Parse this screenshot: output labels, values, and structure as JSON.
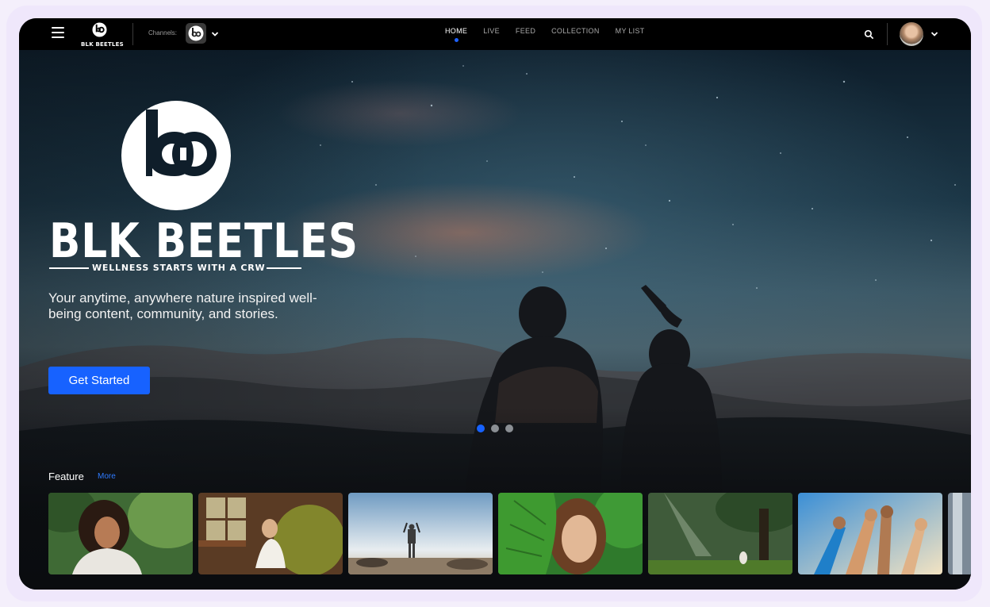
{
  "brand": {
    "name": "BLK BEETLES",
    "tagline": "WELLNESS STARTS WITH A CRW",
    "logo_icon": "bb-logo-icon"
  },
  "topbar": {
    "menu_icon": "menu-icon",
    "channels_label": "Channels:",
    "nav": [
      {
        "label": "HOME",
        "active": true
      },
      {
        "label": "LIVE",
        "active": false
      },
      {
        "label": "FEED",
        "active": false
      },
      {
        "label": "COLLECTION",
        "active": false
      },
      {
        "label": "MY LIST",
        "active": false
      }
    ],
    "search_icon": "search-icon",
    "profile_chevron_icon": "chevron-down-icon"
  },
  "hero": {
    "description": "Your anytime, anywhere nature inspired well-being content, community, and stories.",
    "cta_label": "Get Started",
    "slides_total": 3,
    "active_slide": 1
  },
  "feature": {
    "title": "Feature",
    "more_label": "More",
    "cards": [
      {
        "subject": "smiling woman with curly hair"
      },
      {
        "subject": "woman meditating near window"
      },
      {
        "subject": "person with raised arms on beach"
      },
      {
        "subject": "woman behind monstera leaf"
      },
      {
        "subject": "person sitting in sunlit forest"
      },
      {
        "subject": "raised hands against sky"
      },
      {
        "subject": "partial card"
      }
    ]
  },
  "colors": {
    "accent": "#1762ff",
    "topbar": "#000000",
    "more_link": "#2f7bff"
  }
}
